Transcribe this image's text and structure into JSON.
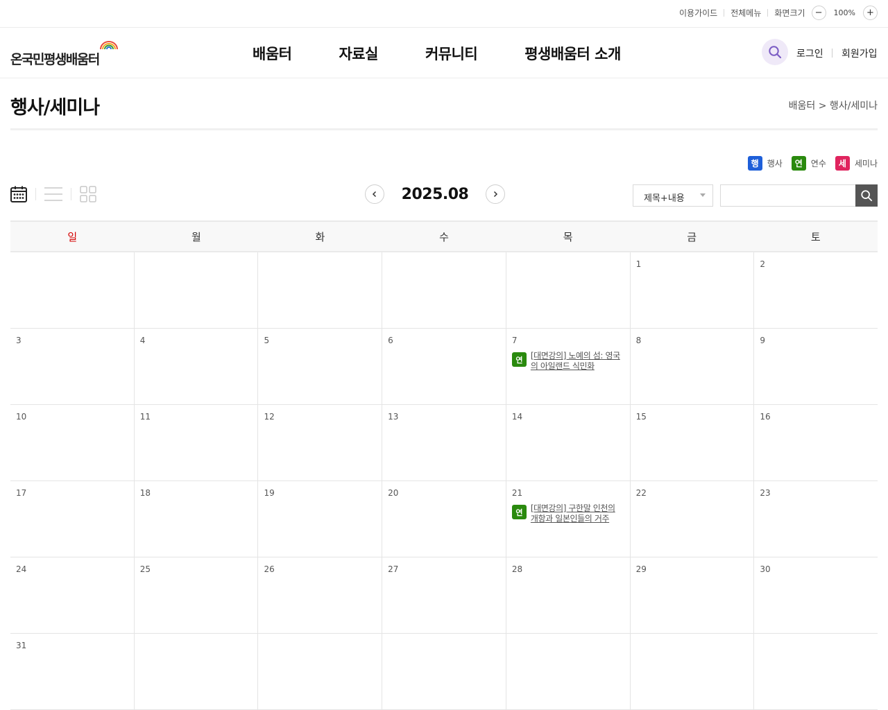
{
  "util": {
    "guide": "이용가이드",
    "all_menu": "전체메뉴",
    "screen_size": "화면크기",
    "zoom_out": "−",
    "zoom_level": "100%",
    "zoom_in": "+"
  },
  "header": {
    "logo_text": "온국민평생배움터",
    "nav": [
      "배움터",
      "자료실",
      "커뮤니티",
      "평생배움터 소개"
    ],
    "login": "로그인",
    "signup": "회원가입",
    "search_icon": "search-icon"
  },
  "page": {
    "title": "행사/세미나",
    "breadcrumb": "배움터 > 행사/세미나"
  },
  "legend": [
    {
      "badge": "행",
      "label": "행사",
      "color": "#1e5fd9"
    },
    {
      "badge": "연",
      "label": "연수",
      "color": "#2a8a0e"
    },
    {
      "badge": "세",
      "label": "세미나",
      "color": "#e0245e"
    }
  ],
  "toolbar": {
    "month": "2025.08",
    "search_scope": "제목+내용",
    "search_value": "",
    "view_icons": [
      "calendar-view-icon",
      "list-view-icon",
      "grid-view-icon"
    ]
  },
  "calendar": {
    "weekdays": [
      "일",
      "월",
      "화",
      "수",
      "목",
      "금",
      "토"
    ],
    "weeks": [
      [
        "",
        "",
        "",
        "",
        "",
        "1",
        "2"
      ],
      [
        "3",
        "4",
        "5",
        "6",
        "7",
        "8",
        "9"
      ],
      [
        "10",
        "11",
        "12",
        "13",
        "14",
        "15",
        "16"
      ],
      [
        "17",
        "18",
        "19",
        "20",
        "21",
        "22",
        "23"
      ],
      [
        "24",
        "25",
        "26",
        "27",
        "28",
        "29",
        "30"
      ],
      [
        "31",
        "",
        "",
        "",
        "",
        "",
        ""
      ]
    ],
    "events": [
      {
        "week": 1,
        "day": 4,
        "badge": "연",
        "title": "[대면강의] 노예의 섬: 영국의 아일랜드 식민화"
      },
      {
        "week": 3,
        "day": 4,
        "badge": "연",
        "title": "[대면강의] 구한말 인천의 개항과 일본인들의 거주"
      }
    ]
  }
}
